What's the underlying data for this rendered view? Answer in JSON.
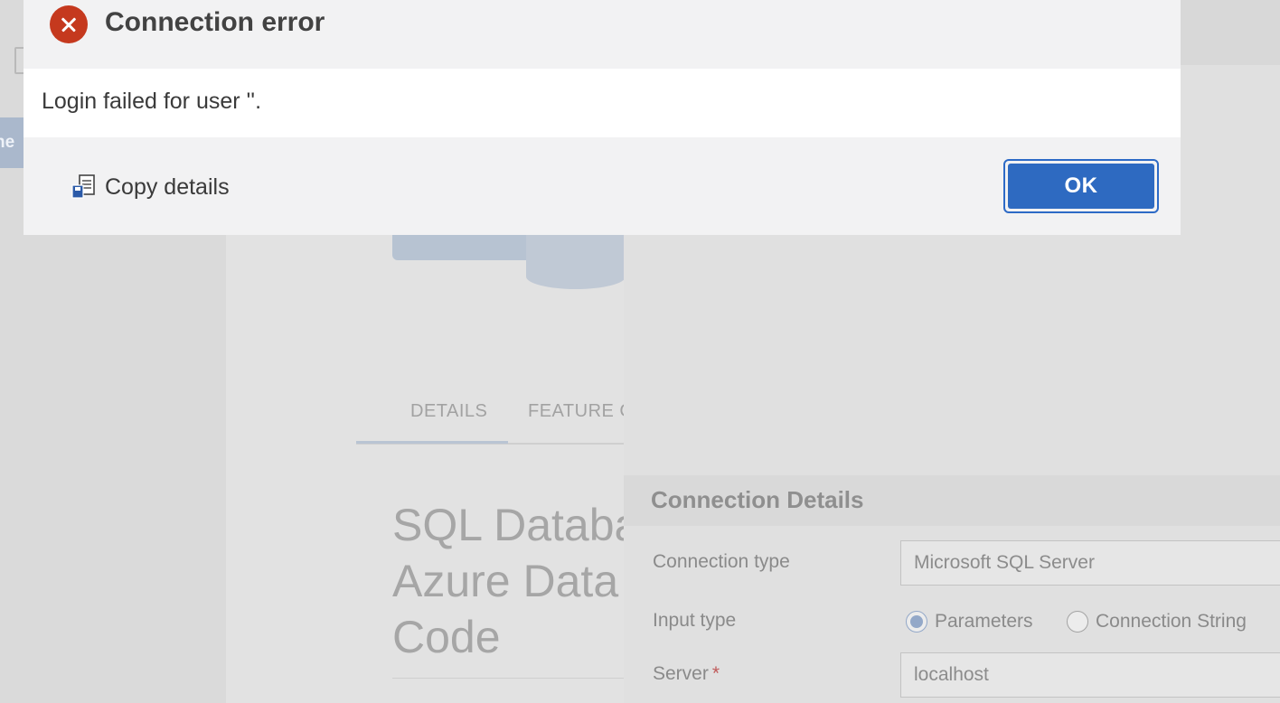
{
  "background": {
    "rail_tab_label": "ne",
    "welcome": {
      "tabs": [
        "DETAILS",
        "FEATURE C"
      ],
      "product_title": "SQL Databa\nAzure Data\nCode"
    },
    "connection_details": {
      "header": "Connection Details",
      "connection_type_label": "Connection type",
      "connection_type_value": "Microsoft SQL Server",
      "input_type_label": "Input type",
      "input_type_options": [
        "Parameters",
        "Connection String"
      ],
      "input_type_selected": "Parameters",
      "server_label": "Server",
      "server_required_marker": "*",
      "server_value": "localhost"
    }
  },
  "dialog": {
    "title": "Connection error",
    "icon": "error-circle-x-icon",
    "message": "Login failed for user ''.",
    "copy_details_label": "Copy details",
    "copy_icon": "copy-document-icon",
    "ok_label": "OK"
  },
  "colors": {
    "error_red": "#c5391e",
    "primary_blue": "#2e6ac1",
    "dialog_bg": "#f2f2f3",
    "message_bg": "#ffffff"
  }
}
